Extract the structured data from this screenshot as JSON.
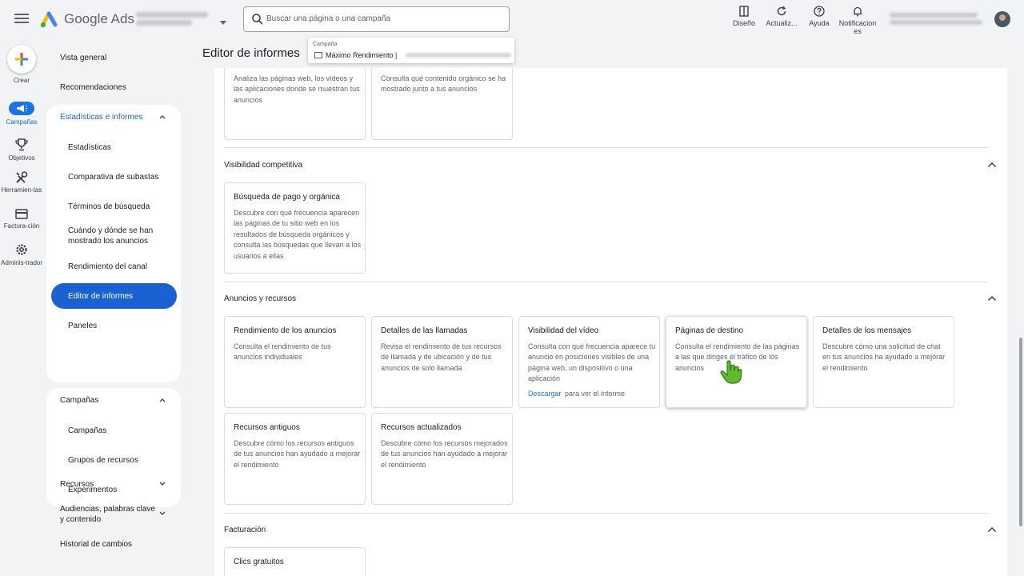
{
  "header": {
    "brand": "Google Ads",
    "search_placeholder": "Buscar una página o una campaña",
    "tools": [
      {
        "label": "Diseño",
        "icon": "layout-icon"
      },
      {
        "label": "Actualiz...",
        "icon": "refresh-icon"
      },
      {
        "label": "Ayuda",
        "icon": "help-icon"
      },
      {
        "label": "Notificacion es",
        "icon": "bell-icon"
      }
    ]
  },
  "rail": {
    "create": "Crear",
    "items": [
      "Campañas",
      "Objetivos",
      "Herramien-tas",
      "Factura-ción",
      "Adminis-trador"
    ]
  },
  "nav": {
    "top_items": [
      "Vista general",
      "Recomendaciones"
    ],
    "stats_section": {
      "title": "Estadísticas e informes",
      "items": [
        "Estadísticas",
        "Comparativa de subastas",
        "Términos de búsqueda",
        "Cuándo y dónde se han mostrado los anuncios",
        "Rendimiento del canal",
        "Editor de informes",
        "Paneles"
      ],
      "selected": "Editor de informes"
    },
    "campaigns_section": {
      "title": "Campañas",
      "items": [
        "Campañas",
        "Grupos de recursos",
        "Experimentos"
      ]
    },
    "bottom_items": [
      "Recursos",
      "Audiencias, palabras clave y contenido",
      "Historial de cambios"
    ]
  },
  "page": {
    "title": "Editor de informes",
    "campaign_label": "Campaña",
    "campaign_value": "Máximo Rendimiento |"
  },
  "top_cards": [
    {
      "desc": "Analiza las páginas web, los vídeos y las aplicaciones donde se muestran tus anuncios"
    },
    {
      "desc": "Consulta qué contenido orgánico se ha mostrado junto a tus anuncios"
    }
  ],
  "sections": [
    {
      "title": "Visibilidad competitiva",
      "cards": [
        {
          "title": "Búsqueda de pago y orgánica",
          "desc": "Descubre con qué frecuencia aparecen las páginas de tu sitio web en los resultados de búsqueda orgánicos y consulta las búsquedas que llevan a los usuarios a ellas"
        }
      ]
    },
    {
      "title": "Anuncios y recursos",
      "cards": [
        {
          "title": "Rendimiento de los anuncios",
          "desc": "Consulta el rendimiento de tus anuncios individuales"
        },
        {
          "title": "Detalles de las llamadas",
          "desc": "Revisa el rendimiento de tus recursos de llamada y de ubicación y de tus anuncios de solo llamada"
        },
        {
          "title": "Visibilidad del vídeo",
          "desc": "Consulta con qué frecuencia aparece tu anuncio en posiciones visibles de una página web, un dispositivo o una aplicación",
          "link": "Descargar",
          "link_suffix": "para ver el informe"
        },
        {
          "title": "Páginas de destino",
          "desc": "Consulta el rendimiento de las páginas a las que diriges el tráfico de los anuncios"
        },
        {
          "title": "Detalles de los mensajes",
          "desc": "Descubre cómo una solicitud de chat en tus anuncios ha ayudado a mejorar el rendimiento"
        },
        {
          "title": "Recursos antiguos",
          "desc": "Descubre cómo los recursos antiguos de tus anuncios han ayudado a mejorar el rendimiento"
        },
        {
          "title": "Recursos actualizados",
          "desc": "Descubre cómo los recursos mejorados de tus anuncios han ayudado a mejorar el rendimiento"
        }
      ]
    },
    {
      "title": "Facturación",
      "cards": [
        {
          "title": "Clics gratuitos"
        }
      ]
    }
  ],
  "colors": {
    "accent": "#1a73e8",
    "selected_nav": "#1a62d1",
    "nav_title": "#1967d2"
  }
}
